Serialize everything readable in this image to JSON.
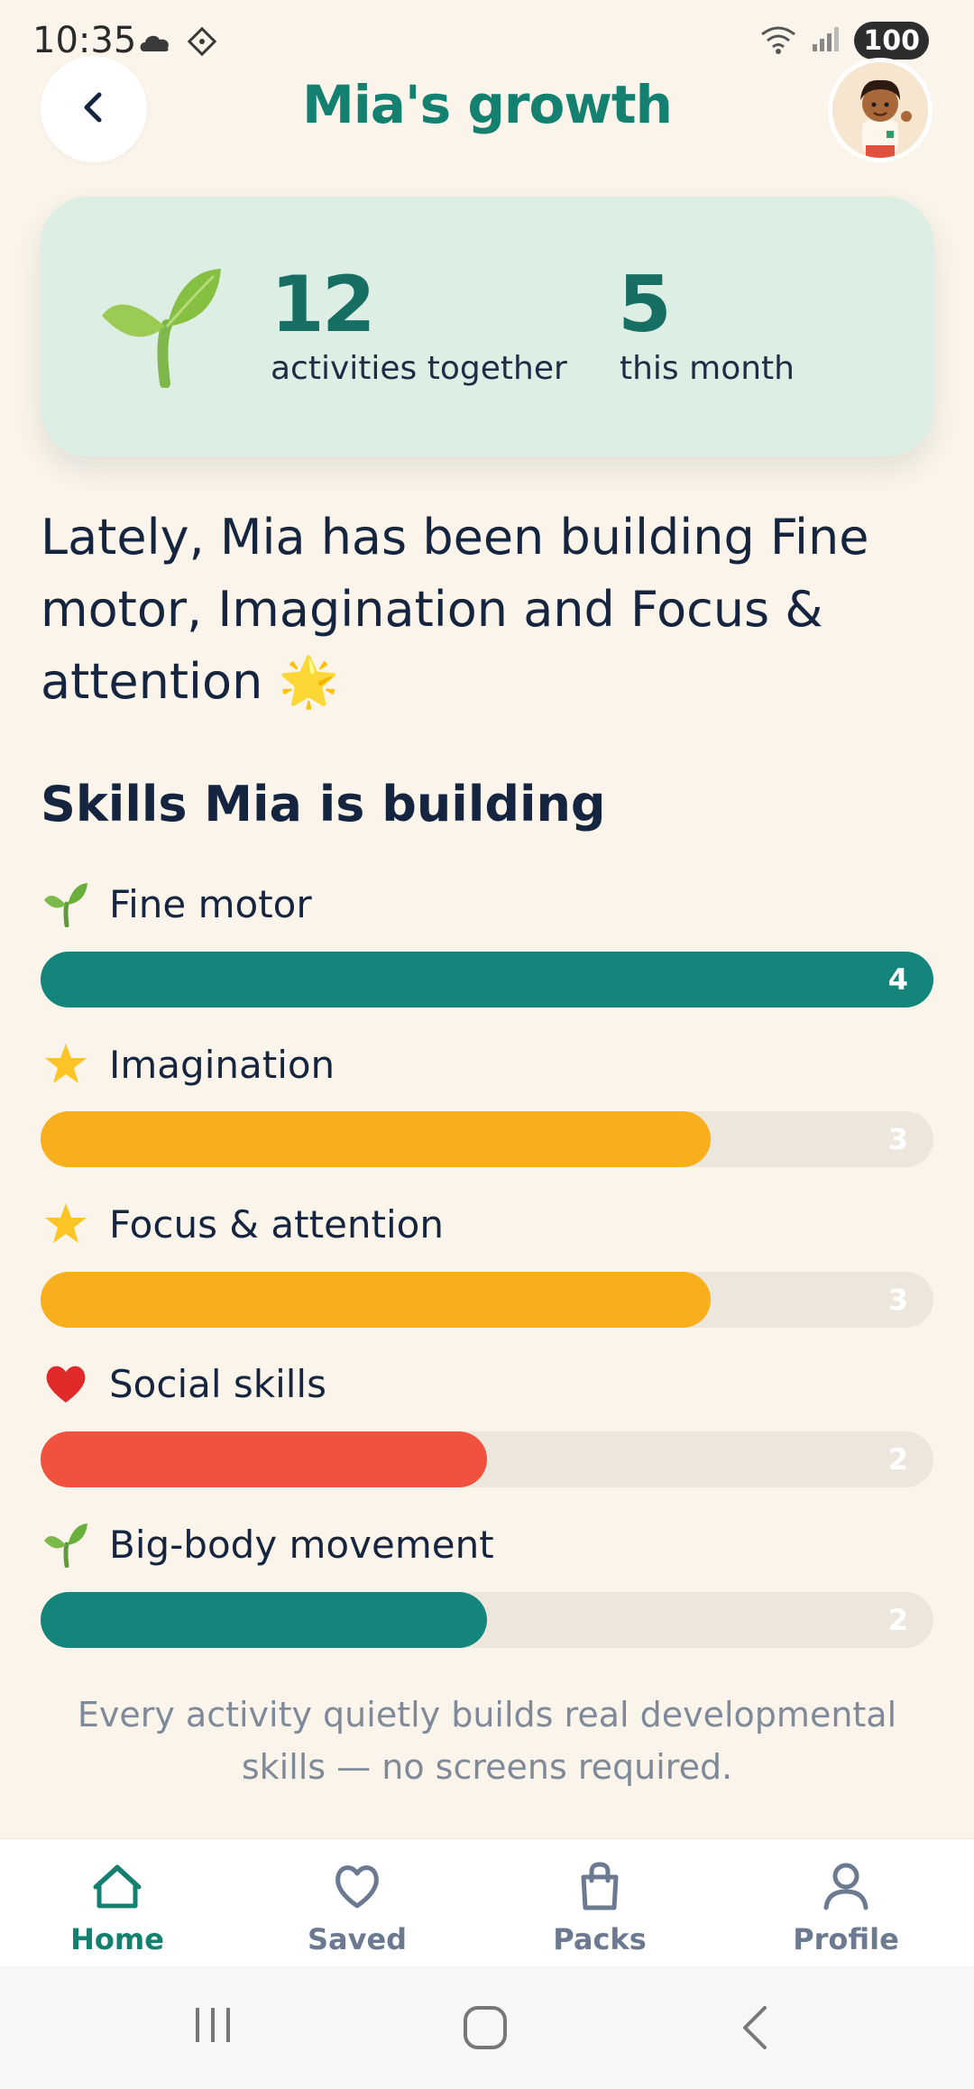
{
  "status_bar": {
    "time": "10:35",
    "battery": "100",
    "icons": [
      "cloud-icon",
      "diamond-icon",
      "wifi-icon",
      "signal-icon"
    ]
  },
  "header": {
    "title": "Mia's growth",
    "back_icon": "chevron-left-icon",
    "avatar": "child-avatar"
  },
  "stats": {
    "activities_count": "12",
    "activities_label": "activities together",
    "month_count": "5",
    "month_label": "this month"
  },
  "summary_text": "Lately, Mia has been building Fine motor, Imagination and Focus & attention 🌟",
  "skills_section": {
    "title": "Skills Mia is building",
    "max": 4,
    "skills": [
      {
        "label": "Fine motor",
        "count": "4",
        "value": 4,
        "color": "#14857a",
        "icon": "sprout-icon"
      },
      {
        "label": "Imagination",
        "count": "3",
        "value": 3,
        "color": "#f9ae1b",
        "icon": "star-icon"
      },
      {
        "label": "Focus & attention",
        "count": "3",
        "value": 3,
        "color": "#f9ae1b",
        "icon": "star-icon"
      },
      {
        "label": "Social skills",
        "count": "2",
        "value": 2,
        "color": "#f0523f",
        "icon": "heart-icon"
      },
      {
        "label": "Big-body movement",
        "count": "2",
        "value": 2,
        "color": "#14857a",
        "icon": "sprout-icon"
      }
    ]
  },
  "footnote": "Every activity quietly builds real developmental skills — no screens required.",
  "bottom_nav": {
    "items": [
      {
        "label": "Home",
        "icon": "home-icon",
        "active": true
      },
      {
        "label": "Saved",
        "icon": "heart-outline-icon",
        "active": false
      },
      {
        "label": "Packs",
        "icon": "bag-icon",
        "active": false
      },
      {
        "label": "Profile",
        "icon": "person-icon",
        "active": false
      }
    ],
    "active_color": "#14806f",
    "inactive_color": "#6b7a90"
  }
}
